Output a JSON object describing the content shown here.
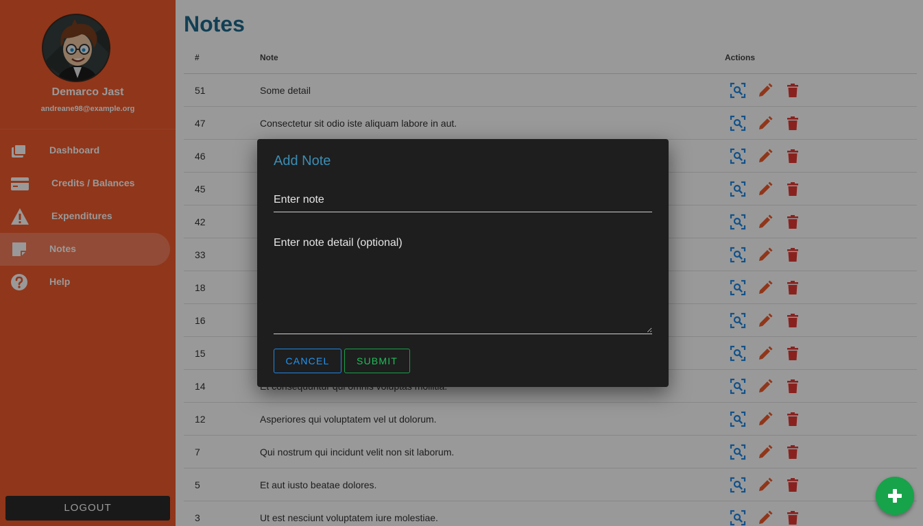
{
  "sidebar": {
    "user": {
      "name": "Demarco Jast",
      "email": "andreane98@example.org"
    },
    "items": [
      {
        "label": "Dashboard",
        "icon": "dashboard-icon",
        "active": false
      },
      {
        "label": "Credits / Balances",
        "icon": "credit-card-icon",
        "active": false
      },
      {
        "label": "Expenditures",
        "icon": "warning-icon",
        "active": false
      },
      {
        "label": "Notes",
        "icon": "note-icon",
        "active": true
      },
      {
        "label": "Help",
        "icon": "help-icon",
        "active": false
      }
    ],
    "logout_label": "LOGOUT"
  },
  "main": {
    "title": "Notes",
    "table": {
      "headers": {
        "id": "#",
        "note": "Note",
        "actions": "Actions"
      },
      "rows": [
        {
          "id": "51",
          "note": "Some detail"
        },
        {
          "id": "47",
          "note": "Consectetur sit odio iste aliquam labore in aut."
        },
        {
          "id": "46",
          "note": ""
        },
        {
          "id": "45",
          "note": ""
        },
        {
          "id": "42",
          "note": ""
        },
        {
          "id": "33",
          "note": ""
        },
        {
          "id": "18",
          "note": ""
        },
        {
          "id": "16",
          "note": ""
        },
        {
          "id": "15",
          "note": ""
        },
        {
          "id": "14",
          "note": "Et consequuntur qui omnis voluptas mollitia."
        },
        {
          "id": "12",
          "note": "Asperiores qui voluptatem vel ut dolorum."
        },
        {
          "id": "7",
          "note": "Qui nostrum qui incidunt velit non sit laborum."
        },
        {
          "id": "5",
          "note": "Et aut iusto beatae dolores."
        },
        {
          "id": "3",
          "note": "Ut est nesciunt voluptatem iure molestiae."
        }
      ],
      "action_icons": [
        "zoom-icon",
        "edit-icon",
        "delete-icon"
      ]
    }
  },
  "dialog": {
    "title": "Add Note",
    "note_placeholder": "Enter note",
    "detail_placeholder": "Enter note detail (optional)",
    "cancel_label": "CANCEL",
    "submit_label": "SUBMIT"
  },
  "fab": {
    "icon": "plus-icon"
  },
  "colors": {
    "sidebar": "#f05a2c",
    "title": "#1f6a8c",
    "view_action": "#1e88e5",
    "edit_action": "#f05a2c",
    "delete_action": "#e53935",
    "fab": "#17a34a",
    "dialog_bg": "#1e1e1e",
    "dialog_title": "#3b8db4",
    "cancel": "#2196f3",
    "submit": "#1fbf5b"
  }
}
